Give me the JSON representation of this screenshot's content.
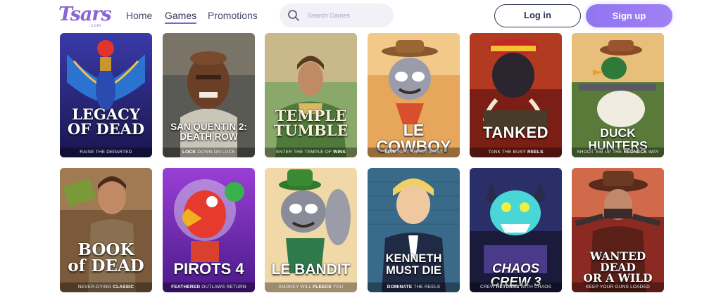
{
  "logo": {
    "text": "Tsars",
    "subtext": ".com"
  },
  "nav": {
    "items": [
      {
        "label": "Home",
        "active": false
      },
      {
        "label": "Games",
        "active": true
      },
      {
        "label": "Promotions",
        "active": false
      }
    ]
  },
  "search": {
    "placeholder": "Search Games",
    "icon": "search-icon"
  },
  "auth": {
    "login_label": "Log in",
    "signup_label": "Sign up"
  },
  "colors": {
    "accent": "#8b63d6",
    "signup_bg": "#9b7cf3",
    "text_dark": "#2f3553"
  },
  "games": [
    {
      "title_lines": [
        "LEGACY",
        "OF DEAD"
      ],
      "tag_pre": "RAISE",
      "tag_bold": "",
      "tag_post": "THE DEPARTED"
    },
    {
      "title_lines": [
        "SAN QUENTIN 2:",
        "DEATH ROW"
      ],
      "tag_pre": "",
      "tag_bold": "LOCK",
      "tag_post": "DOWN ON LUCK"
    },
    {
      "title_lines": [
        "TEMPLE",
        "TUMBLE"
      ],
      "tag_pre": "ENTER THE TEMPLE OF",
      "tag_bold": "WINS",
      "tag_post": ""
    },
    {
      "title_lines": [
        "LE COWBOY"
      ],
      "tag_pre": "",
      "tag_bold": "SPIN",
      "tag_post": "FAST SHOOT WEST"
    },
    {
      "title_lines": [
        "TANKED"
      ],
      "tag_pre": "TANK THE BUSY",
      "tag_bold": "REELS",
      "tag_post": ""
    },
    {
      "title_lines": [
        "DUCK HUNTERS"
      ],
      "tag_pre": "SHOOT 'EM UP THE",
      "tag_bold": "REDNECK",
      "tag_post": "WAY"
    },
    {
      "title_lines": [
        "BOOK",
        "of DEAD"
      ],
      "tag_pre": "NEVER-DYING",
      "tag_bold": "CLASSIC",
      "tag_post": ""
    },
    {
      "title_lines": [
        "PIROTS 4"
      ],
      "tag_pre": "",
      "tag_bold": "FEATHERED",
      "tag_post": "OUTLAWS RETURN"
    },
    {
      "title_lines": [
        "LE BANDIT"
      ],
      "tag_pre": "SMOKEY WILL",
      "tag_bold": "FLEECE",
      "tag_post": "YOU"
    },
    {
      "title_lines": [
        "KENNETH",
        "MUST DIE"
      ],
      "tag_pre": "",
      "tag_bold": "DOMINATE",
      "tag_post": "THE REELS"
    },
    {
      "title_lines": [
        "CHAOS CREW 3"
      ],
      "tag_pre": "CREW",
      "tag_bold": "RETURNS",
      "tag_post": "WITH CHAOS"
    },
    {
      "title_lines": [
        "WANTED DEAD",
        "OR A WILD"
      ],
      "tag_pre": "KEEP YOUR GUNS LOADED",
      "tag_bold": "",
      "tag_post": ""
    }
  ]
}
